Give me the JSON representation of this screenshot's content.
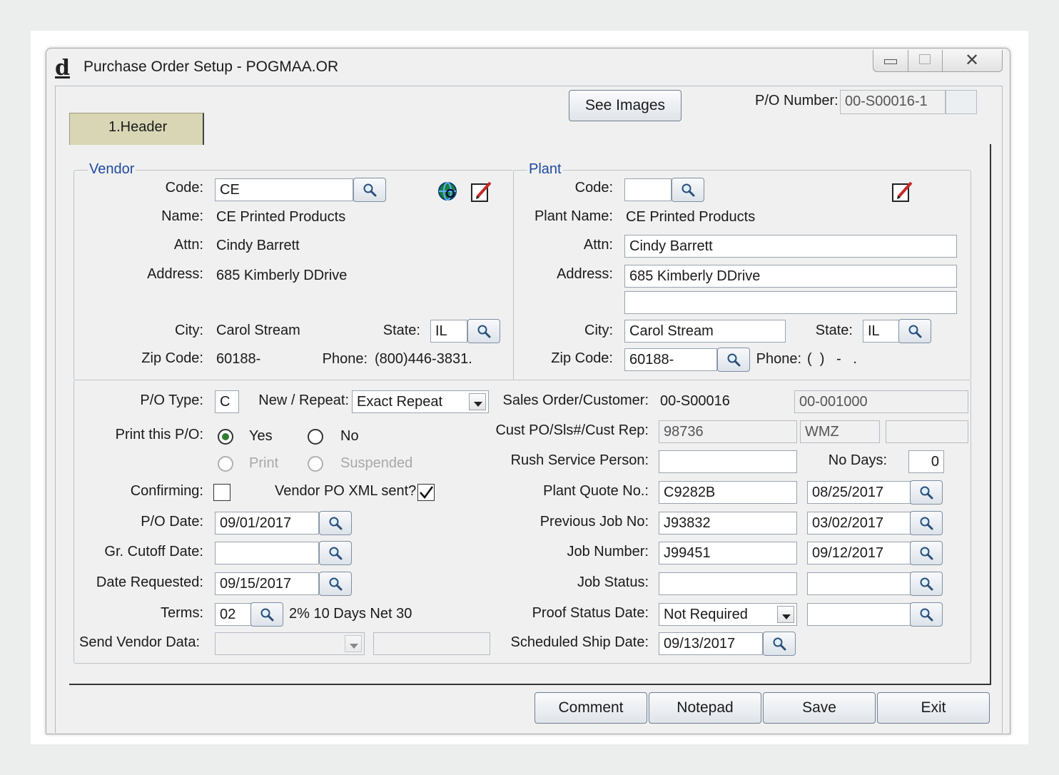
{
  "window": {
    "title": "Purchase Order Setup - POGMAA.OR",
    "logo": "d"
  },
  "toolbar": {
    "see_images": "See Images",
    "po_number_label": "P/O Number:",
    "po_number": "00-S00016-1"
  },
  "tabs": [
    {
      "label": "1.Header"
    }
  ],
  "vendor": {
    "legend": "Vendor",
    "code_label": "Code:",
    "code": "CE",
    "name_label": "Name:",
    "name": "CE Printed Products",
    "attn_label": "Attn:",
    "attn": "Cindy Barrett",
    "address_label": "Address:",
    "address": "685 Kimberly DDrive",
    "city_label": "City:",
    "city": "Carol Stream",
    "state_label": "State:",
    "state": "IL",
    "zip_label": "Zip Code:",
    "zip": "60188-",
    "phone_label": "Phone:",
    "phone": "(800)446-3831."
  },
  "plant": {
    "legend": "Plant",
    "code_label": "Code:",
    "code": "",
    "name_label": "Plant Name:",
    "name": "CE Printed Products",
    "attn_label": "Attn:",
    "attn": "Cindy Barrett",
    "address_label": "Address:",
    "address1": "685 Kimberly DDrive",
    "address2": "",
    "city_label": "City:",
    "city": "Carol Stream",
    "state_label": "State:",
    "state": "IL",
    "zip_label": "Zip Code:",
    "zip": "60188-",
    "phone_label": "Phone:",
    "phone": "(  )   -   ."
  },
  "order": {
    "po_type_label": "P/O Type:",
    "po_type": "C",
    "new_repeat_label": "New / Repeat:",
    "new_repeat": "Exact Repeat",
    "print_label": "Print this P/O:",
    "yes": "Yes",
    "no": "No",
    "print": "Print",
    "suspended": "Suspended",
    "confirming_label": "Confirming:",
    "vendor_xml_label": "Vendor PO XML sent?",
    "po_date_label": "P/O Date:",
    "po_date": "09/01/2017",
    "cutoff_label": "Gr. Cutoff Date:",
    "cutoff": "",
    "requested_label": "Date Requested:",
    "requested": "09/15/2017",
    "terms_label": "Terms:",
    "terms_code": "02",
    "terms_desc": "2% 10 Days Net 30",
    "send_vendor_label": "Send Vendor Data:"
  },
  "right": {
    "so_label": "Sales Order/Customer:",
    "so": "00-S00016",
    "customer": "00-001000",
    "cust_po_label": "Cust PO/Sls#/Cust Rep:",
    "cust_po": "98736",
    "sls": "WMZ",
    "rep": "",
    "rush_label": "Rush Service Person:",
    "rush": "",
    "no_days_label": "No Days:",
    "no_days": "0",
    "quote_label": "Plant Quote No.:",
    "quote": "C9282B",
    "quote_date": "08/25/2017",
    "prev_label": "Previous Job No:",
    "prev": "J93832",
    "prev_date": "03/02/2017",
    "job_label": "Job Number:",
    "job": "J99451",
    "job_date": "09/12/2017",
    "status_label": "Job Status:",
    "status": "",
    "status_date": "",
    "proof_label": "Proof Status Date:",
    "proof": "Not Required",
    "proof_date": "",
    "ship_label": "Scheduled Ship Date:",
    "ship": "09/13/2017"
  },
  "footer": {
    "comment": "Comment",
    "notepad": "Notepad",
    "save": "Save",
    "exit": "Exit"
  }
}
